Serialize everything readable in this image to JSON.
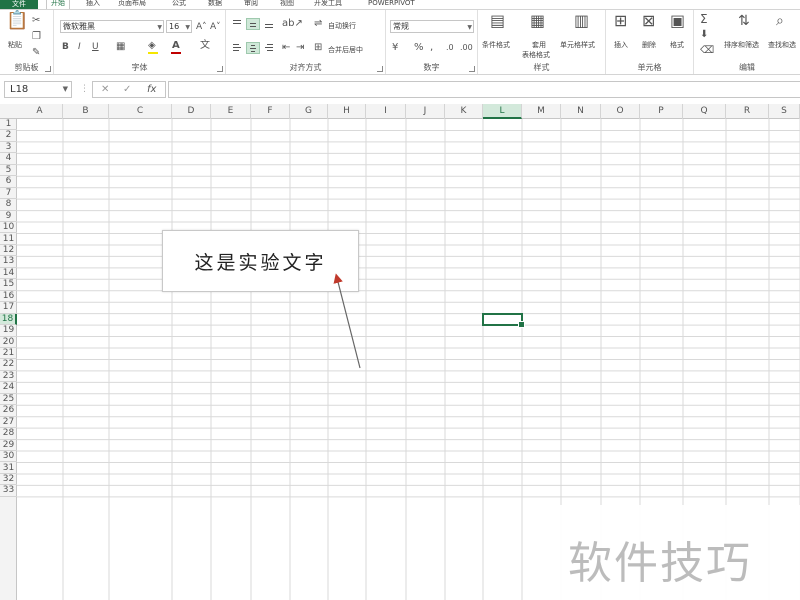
{
  "tabs": {
    "file": "文件",
    "items": [
      "开始",
      "插入",
      "页面布局",
      "公式",
      "数据",
      "审阅",
      "视图",
      "开发工具",
      "POWERPIVOT"
    ],
    "active_index": 0
  },
  "ribbon": {
    "clipboard": {
      "paste": "粘贴",
      "label": "剪贴板"
    },
    "font": {
      "name": "微软雅黑",
      "size": "16",
      "bold": "B",
      "italic": "I",
      "underline": "U",
      "label": "字体",
      "fill_color": "#f5e600",
      "font_color": "#c00000"
    },
    "alignment": {
      "wrap": "自动换行",
      "merge": "合并后居中",
      "label": "对齐方式"
    },
    "number": {
      "format": "常规",
      "percent": "%",
      "label": "数字"
    },
    "styles": {
      "conditional": "条件格式",
      "table_line1": "套用",
      "table_line2": "表格格式",
      "cell_styles": "单元格样式",
      "label": "样式"
    },
    "cells": {
      "insert": "插入",
      "delete": "删除",
      "format": "格式",
      "label": "单元格"
    },
    "editing": {
      "sort": "排序和筛选",
      "find": "查找和选",
      "label": "编辑"
    }
  },
  "formula_bar": {
    "name_box": "L18",
    "cancel": "✕",
    "enter": "✓",
    "fx": "fx",
    "value": ""
  },
  "sheet": {
    "columns": [
      "A",
      "B",
      "C",
      "D",
      "E",
      "F",
      "G",
      "H",
      "I",
      "J",
      "K",
      "L",
      "M",
      "N",
      "O",
      "P",
      "Q",
      "R",
      "S"
    ],
    "rows": [
      "1",
      "2",
      "3",
      "4",
      "5",
      "6",
      "7",
      "8",
      "9",
      "10",
      "11",
      "12",
      "13",
      "14",
      "15",
      "16",
      "17",
      "18",
      "19",
      "20",
      "21",
      "22",
      "23",
      "24",
      "25",
      "26",
      "27",
      "28",
      "29",
      "30",
      "31",
      "32",
      "33"
    ],
    "active_column": "L",
    "active_row": "18"
  },
  "callout": {
    "text": "这是实验文字"
  },
  "watermark": {
    "text": "软件技巧"
  },
  "colors": {
    "accent": "#217346",
    "grid": "#d9d9d9"
  }
}
